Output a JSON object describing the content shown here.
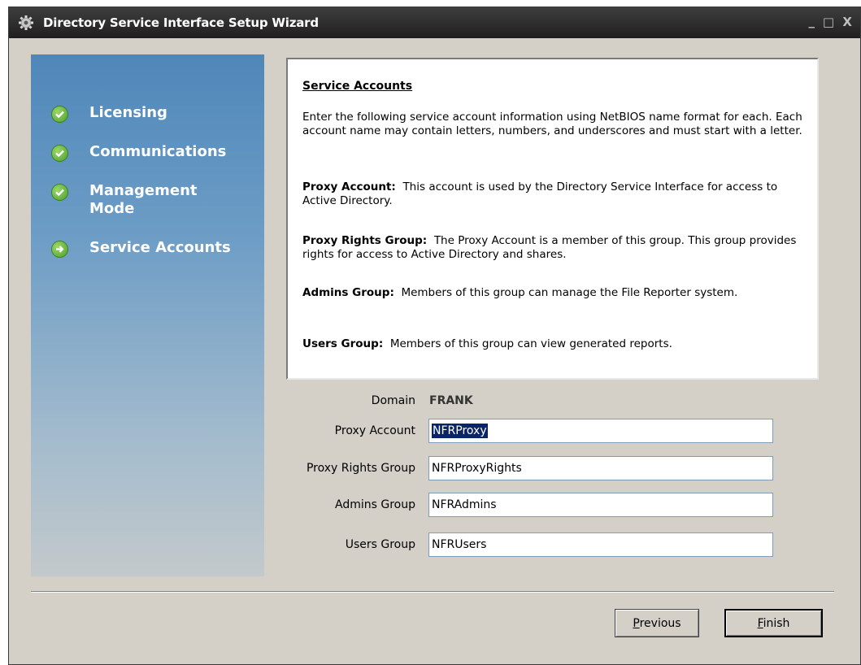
{
  "window": {
    "title": "Directory Service Interface Setup Wizard",
    "controls": {
      "minimize": "_",
      "maximize": "□",
      "close": "X"
    }
  },
  "steps": [
    {
      "label": "Licensing",
      "status": "complete",
      "icon": "check-icon"
    },
    {
      "label": "Communications",
      "status": "complete",
      "icon": "check-icon"
    },
    {
      "label": "Management Mode",
      "status": "complete",
      "icon": "check-icon"
    },
    {
      "label": "Service Accounts",
      "status": "current",
      "icon": "arrow-right-icon"
    }
  ],
  "description": {
    "heading": "Service Accounts",
    "intro": "Enter the following service account information using NetBIOS name format for each.  Each account name may contain letters, numbers, and underscores and must start with a letter.",
    "items": [
      {
        "term": "Proxy Account:",
        "text": "This account is used by the Directory Service Interface for access to Active Directory."
      },
      {
        "term": "Proxy Rights Group:",
        "text": "The Proxy Account is a member of this group.  This group provides rights for access to Active Directory and shares."
      },
      {
        "term": "Admins Group:",
        "text": "Members of this group can manage the File Reporter system."
      },
      {
        "term": "Users Group:",
        "text": "Members of this group can view generated reports."
      }
    ]
  },
  "form": {
    "domain_label": "Domain",
    "domain_value": "FRANK",
    "proxy_account_label": "Proxy Account",
    "proxy_account_value": "NFRProxy",
    "proxy_rights_label": "Proxy Rights Group",
    "proxy_rights_value": "NFRProxyRights",
    "admins_label": "Admins Group",
    "admins_value": "NFRAdmins",
    "users_label": "Users Group",
    "users_value": "NFRUsers"
  },
  "buttons": {
    "previous_mnemonic": "P",
    "previous_rest": "revious",
    "finish_mnemonic": "F",
    "finish_rest": "inish"
  },
  "colors": {
    "sidebar_top": "#4f87b9",
    "sidebar_bottom": "#c3c9cc",
    "titlebar": "#2a2a2a",
    "selection": "#0a246a"
  }
}
